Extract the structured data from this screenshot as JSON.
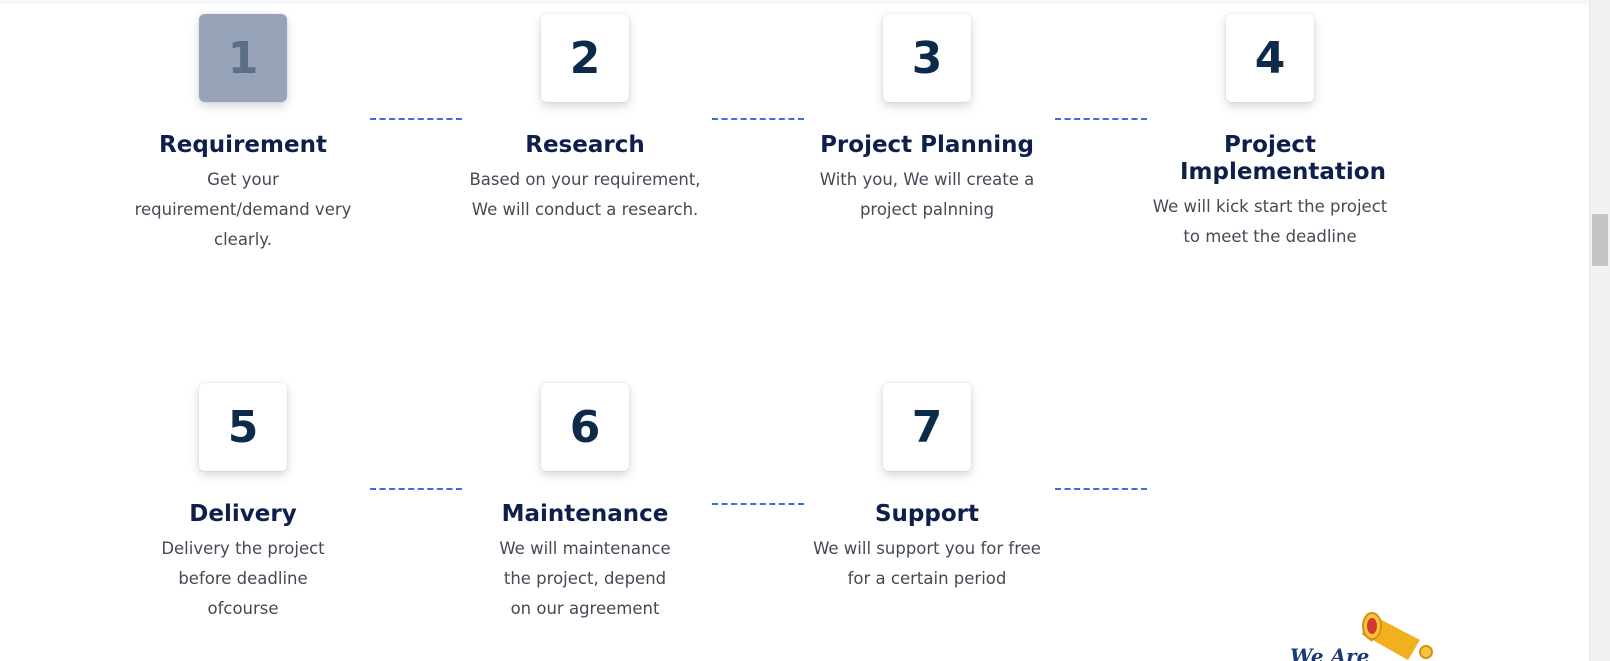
{
  "steps": [
    {
      "number": "1",
      "title": "Requirement",
      "description": "Get your requirement/demand very clearly.",
      "active": true
    },
    {
      "number": "2",
      "title": "Research",
      "description": "Based on your requirement, We will conduct a research.",
      "active": false
    },
    {
      "number": "3",
      "title": "Project Planning",
      "description": "With you, We will create a project palnning",
      "active": false
    },
    {
      "number": "4",
      "title": "Project Implementation",
      "description": "We will kick start the project to meet the deadline",
      "active": false
    },
    {
      "number": "5",
      "title": "Delivery",
      "description": "Delivery the project before deadline ofcourse",
      "active": false
    },
    {
      "number": "6",
      "title": "Maintenance",
      "description": "We will maintenance the project, depend on our agreement",
      "active": false
    },
    {
      "number": "7",
      "title": "Support",
      "description": "We will support you for free for a certain period",
      "active": false
    }
  ],
  "promo": {
    "text": "We Are",
    "icon": "megaphone-icon"
  },
  "colors": {
    "accent": "#3a6fe0",
    "title": "#0d1f4a",
    "number": "#0c2a4a",
    "active_box": "#97a3b8"
  }
}
